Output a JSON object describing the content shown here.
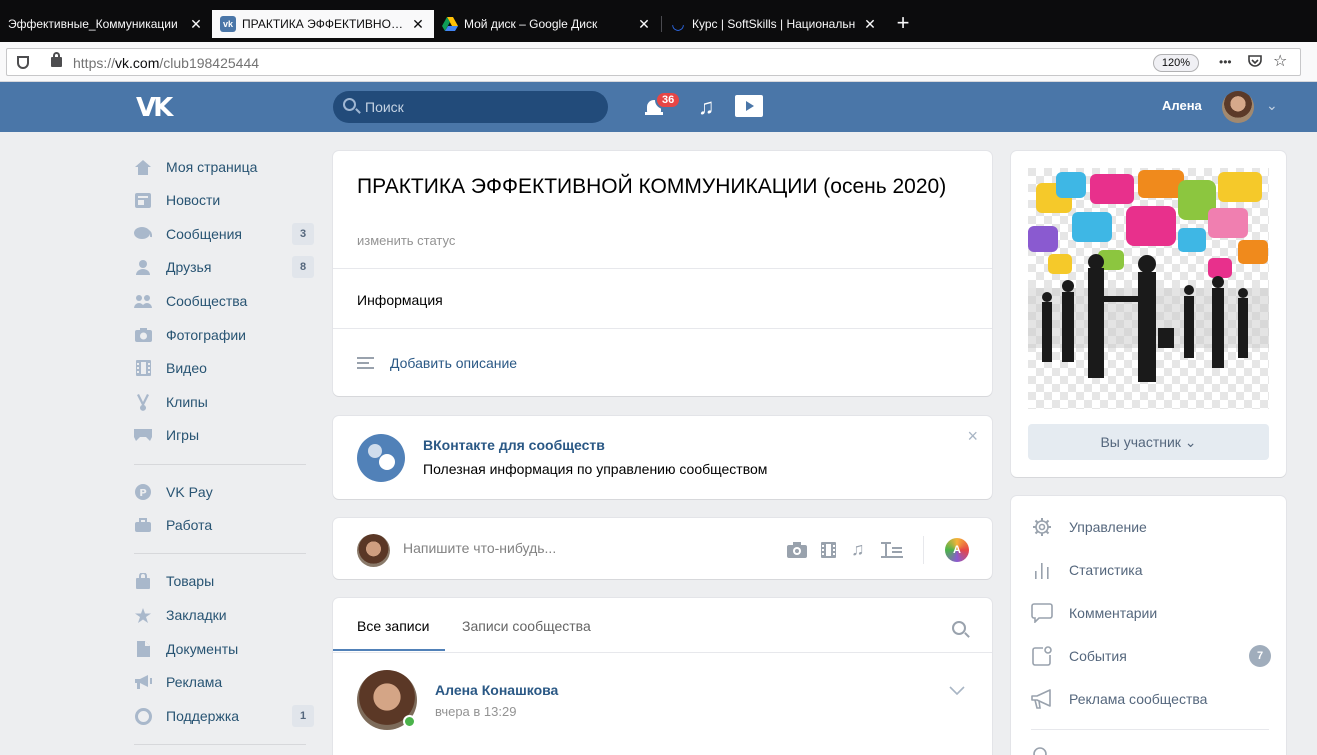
{
  "browser": {
    "tabs": [
      {
        "title": "Эффективные_Коммуникации",
        "active": false
      },
      {
        "title": "ПРАКТИКА ЭФФЕКТИВНОЙ К",
        "active": true
      },
      {
        "title": "Мой диск – Google Диск",
        "active": false
      },
      {
        "title": "Курс | SoftSkills | Национальн",
        "active": false
      }
    ],
    "new_tab": "+",
    "url_prefix": "https://",
    "url_domain": "vk.com",
    "url_path": "/club198425444",
    "zoom": "120%",
    "menu_dots": "•••"
  },
  "vk_header": {
    "logo": "VK",
    "search_placeholder": "Поиск",
    "notifications_count": "36",
    "user_name": "Алена"
  },
  "left_nav": {
    "items": [
      {
        "label": "Моя страница",
        "icon": "home-icon",
        "count": ""
      },
      {
        "label": "Новости",
        "icon": "news-icon",
        "count": ""
      },
      {
        "label": "Сообщения",
        "icon": "messages-icon",
        "count": "3"
      },
      {
        "label": "Друзья",
        "icon": "friends-icon",
        "count": "8"
      },
      {
        "label": "Сообщества",
        "icon": "groups-icon",
        "count": ""
      },
      {
        "label": "Фотографии",
        "icon": "camera-icon",
        "count": ""
      },
      {
        "label": "Видео",
        "icon": "film-icon",
        "count": ""
      },
      {
        "label": "Клипы",
        "icon": "clips-icon",
        "count": ""
      },
      {
        "label": "Игры",
        "icon": "gamepad-icon",
        "count": ""
      }
    ],
    "items2": [
      {
        "label": "VK Pay",
        "icon": "vkpay-icon",
        "count": ""
      },
      {
        "label": "Работа",
        "icon": "briefcase-icon",
        "count": ""
      }
    ],
    "items3": [
      {
        "label": "Товары",
        "icon": "shopping-bag-icon",
        "count": ""
      },
      {
        "label": "Закладки",
        "icon": "star-icon",
        "count": ""
      },
      {
        "label": "Документы",
        "icon": "document-icon",
        "count": ""
      },
      {
        "label": "Реклама",
        "icon": "megaphone-icon",
        "count": ""
      },
      {
        "label": "Поддержка",
        "icon": "lifebuoy-icon",
        "count": "1"
      }
    ]
  },
  "group": {
    "title": "ПРАКТИКА ЭФФЕКТИВНОЙ КОММУНИКАЦИИ (осень 2020)",
    "status": "изменить статус",
    "info_label": "Информация",
    "add_description": "Добавить описание"
  },
  "promo": {
    "title": "ВКонтакте для сообществ",
    "text": "Полезная информация по управлению сообществом",
    "close": "×"
  },
  "compose": {
    "placeholder": "Напишите что-нибудь...",
    "author_button": "A"
  },
  "wall": {
    "tab_all": "Все записи",
    "tab_community": "Записи сообщества",
    "post": {
      "author": "Алена Конашкова",
      "time": "вчера в 13:29"
    }
  },
  "right": {
    "member_button": "Вы участник ⌄",
    "admin_items": [
      {
        "label": "Управление",
        "icon": "gear-icon",
        "count": ""
      },
      {
        "label": "Статистика",
        "icon": "stats-icon",
        "count": ""
      },
      {
        "label": "Комментарии",
        "icon": "comment-icon",
        "count": ""
      },
      {
        "label": "События",
        "icon": "events-icon",
        "count": "7"
      },
      {
        "label": "Реклама сообщества",
        "icon": "megaphone-icon",
        "count": ""
      }
    ]
  },
  "colors": {
    "vk_blue": "#4a76a8",
    "link": "#2a5885",
    "background": "#edeef0"
  }
}
